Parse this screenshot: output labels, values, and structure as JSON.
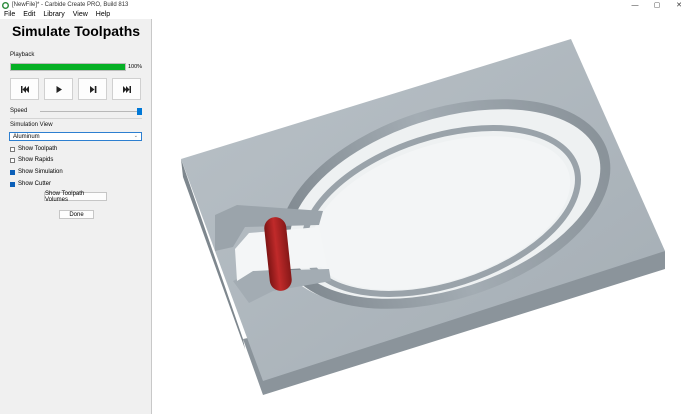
{
  "window": {
    "title": "[NewFile]* - Carbide Create PRO, Build 813",
    "controls": [
      "—",
      "▢",
      "✕"
    ]
  },
  "menu": [
    "File",
    "Edit",
    "Library",
    "View",
    "Help"
  ],
  "panel": {
    "title": "Simulate Toolpaths",
    "playback_label": "Playback",
    "progress_text": "100%",
    "progress_value": 1.0,
    "speed_label": "Speed",
    "speed_value": 1.0,
    "simulation_view_label": "Simulation View",
    "material_select": "Aluminum",
    "checkboxes": [
      {
        "label": "Show Toolpath",
        "checked": false
      },
      {
        "label": "Show Rapids",
        "checked": false
      },
      {
        "label": "Show Simulation",
        "checked": true
      },
      {
        "label": "Show Cutter",
        "checked": true
      }
    ],
    "show_volumes_label": "Show Toolpath Volumes",
    "done_label": "Done"
  },
  "icons": {
    "app": "carbide-logo-icon",
    "rewind": "skip-to-start-icon",
    "play": "play-icon",
    "step": "step-forward-icon",
    "end": "skip-to-end-icon"
  },
  "colors": {
    "progress": "#06b025",
    "accent": "#0078d7",
    "stock": "#a7b0b6",
    "cutter": "#b32222"
  }
}
